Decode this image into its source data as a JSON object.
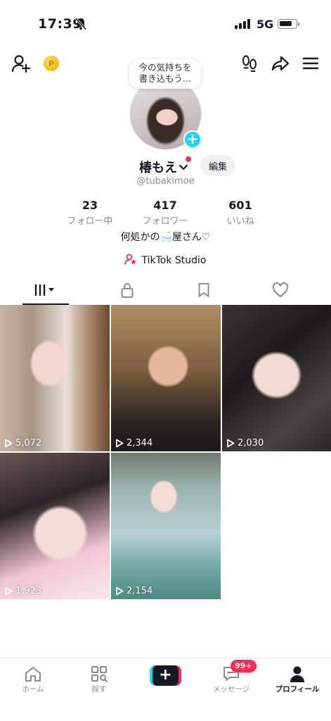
{
  "status": {
    "time": "17:39",
    "network": "5G"
  },
  "bubble": {
    "line1": "今の気持ちを",
    "line2": "書き込もう…"
  },
  "profile": {
    "name": "椿もえ",
    "edit_label": "編集",
    "handle": "@tubakimoe",
    "bio": "何処かの🛁屋さん♡",
    "studio_label": "TikTok Studio"
  },
  "stats": [
    {
      "num": "23",
      "label": "フォロー中"
    },
    {
      "num": "417",
      "label": "フォロワー"
    },
    {
      "num": "601",
      "label": "いいね"
    }
  ],
  "videos": [
    {
      "views": "5,072"
    },
    {
      "views": "2,344"
    },
    {
      "views": "2,030"
    },
    {
      "views": "1,923"
    },
    {
      "views": "2,154"
    }
  ],
  "nav": {
    "home": "ホーム",
    "discover": "探す",
    "messages": "メッセージ",
    "messages_badge": "99+",
    "profile": "プロフィール"
  },
  "colors": {
    "accent_red": "#fe2c55",
    "accent_cyan": "#20d5ec",
    "text": "#161823",
    "muted": "#8a8b91"
  }
}
